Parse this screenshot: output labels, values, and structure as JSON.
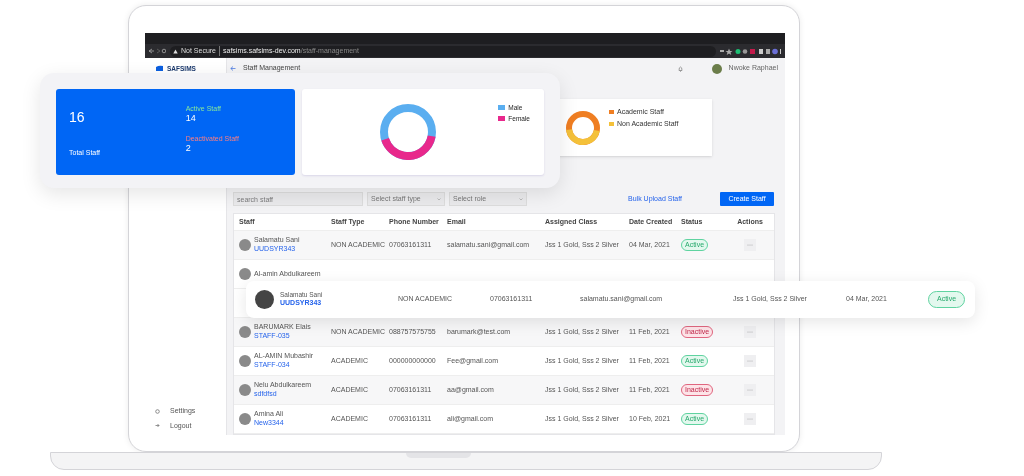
{
  "browser": {
    "security": "Not Secure",
    "host": "safsims.safsims-dev.com",
    "path": "/staff-management"
  },
  "sidebar": {
    "logo": "SAFSIMS",
    "bottom_items": [
      {
        "label": "Settings",
        "kind": "settings"
      },
      {
        "label": "Logout",
        "kind": "logout"
      }
    ]
  },
  "header": {
    "title": "Staff Management",
    "user": "Nwoke Raphael"
  },
  "type_card": {
    "legend": [
      {
        "label": "Academic Staff",
        "color": "#ef7e22"
      },
      {
        "label": "Non Academic Staff",
        "color": "#f4c13a"
      }
    ]
  },
  "filters": {
    "search_placeholder": "search staff",
    "selects": [
      "Select staff type",
      "Select role"
    ],
    "bulk_link": "Bulk Upload Staff",
    "create_button": "Create Staff"
  },
  "table": {
    "columns": [
      "Staff",
      "Staff Type",
      "Phone Number",
      "Email",
      "Assigned Class",
      "Date Created",
      "Status",
      "Actions"
    ],
    "rows": [
      {
        "name": "Salamatu Sani",
        "id": "UUDSYR343",
        "type": "NON ACADEMIC",
        "phone": "07063161311",
        "email": "salamatu.sani@gmail.com",
        "class": "Jss 1 Gold, Sss 2 Silver",
        "date": "04 Mar, 2021",
        "status": "Active",
        "active": true
      },
      {
        "name": "Al-amin Abdulkareem"
      },
      {
        "name": "BARUMARK Elais",
        "id": "STAFF-035",
        "type": "NON ACADEMIC",
        "phone": "088757575755",
        "email": "barumark@test.com",
        "class": "Jss 1 Gold, Sss 2 Silver",
        "date": "11 Feb, 2021",
        "status": "Inactive",
        "active": false
      },
      {
        "name": "AL-AMIN Mubashir",
        "id": "STAFF-034",
        "type": "ACADEMIC",
        "phone": "000000000000",
        "email": "Fee@gmail.com",
        "class": "Jss 1 Gold, Sss 2 Silver",
        "date": "11 Feb, 2021",
        "status": "Active",
        "active": true
      },
      {
        "name": "Nelu Abdulkareem",
        "id": "sdfdfsd",
        "type": "ACADEMIC",
        "phone": "07063161311",
        "email": "aa@gmail.com",
        "class": "Jss 1 Gold, Sss 2 Silver",
        "date": "11 Feb, 2021",
        "status": "Inactive",
        "active": false
      },
      {
        "name": "Amina Ali",
        "id": "New3344",
        "type": "ACADEMIC",
        "phone": "07063161311",
        "email": "ali@gmail.com",
        "class": "Jss 1 Gold, Sss 2 Silver",
        "date": "10 Feb, 2021",
        "status": "Active",
        "active": true
      }
    ]
  },
  "stats": {
    "total": "16",
    "total_label": "Total Staff",
    "active_label": "Active Staff",
    "active": "14",
    "deactivated_label": "Deactivated Staff",
    "deactivated": "2"
  },
  "gender_card": {
    "legend": [
      {
        "label": "Male",
        "color": "#5aaef0"
      },
      {
        "label": "Female",
        "color": "#e8288c"
      }
    ]
  },
  "highlight_row": {
    "name": "Salamatu Sani",
    "id": "UUDSYR343",
    "type": "NON ACADEMIC",
    "phone": "07063161311",
    "email": "salamatu.sani@gmail.com",
    "class": "Jss 1 Gold, Sss 2 Silver",
    "date": "04 Mar, 2021",
    "status": "Active",
    "active": true
  }
}
